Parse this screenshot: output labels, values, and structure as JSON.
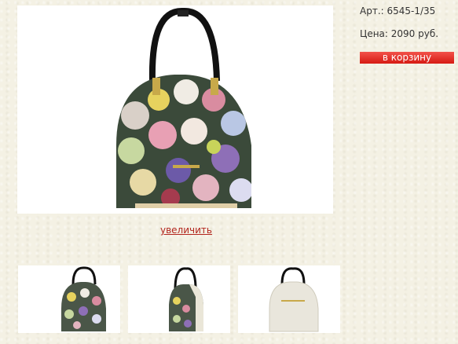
{
  "product": {
    "sku_label": "Арт.: 6545-1/35",
    "price_label": "Цена: 2090 руб.",
    "cart_button": "в корзину",
    "zoom_link": "увеличить"
  },
  "colors": {
    "accent_red": "#e22a22",
    "link_red": "#b3261e",
    "background": "#f4f1e4"
  },
  "thumbnails": [
    {
      "name": "thumbnail-floral-front",
      "variant": "floral"
    },
    {
      "name": "thumbnail-floral-side",
      "variant": "floral"
    },
    {
      "name": "thumbnail-white-back",
      "variant": "white"
    }
  ]
}
